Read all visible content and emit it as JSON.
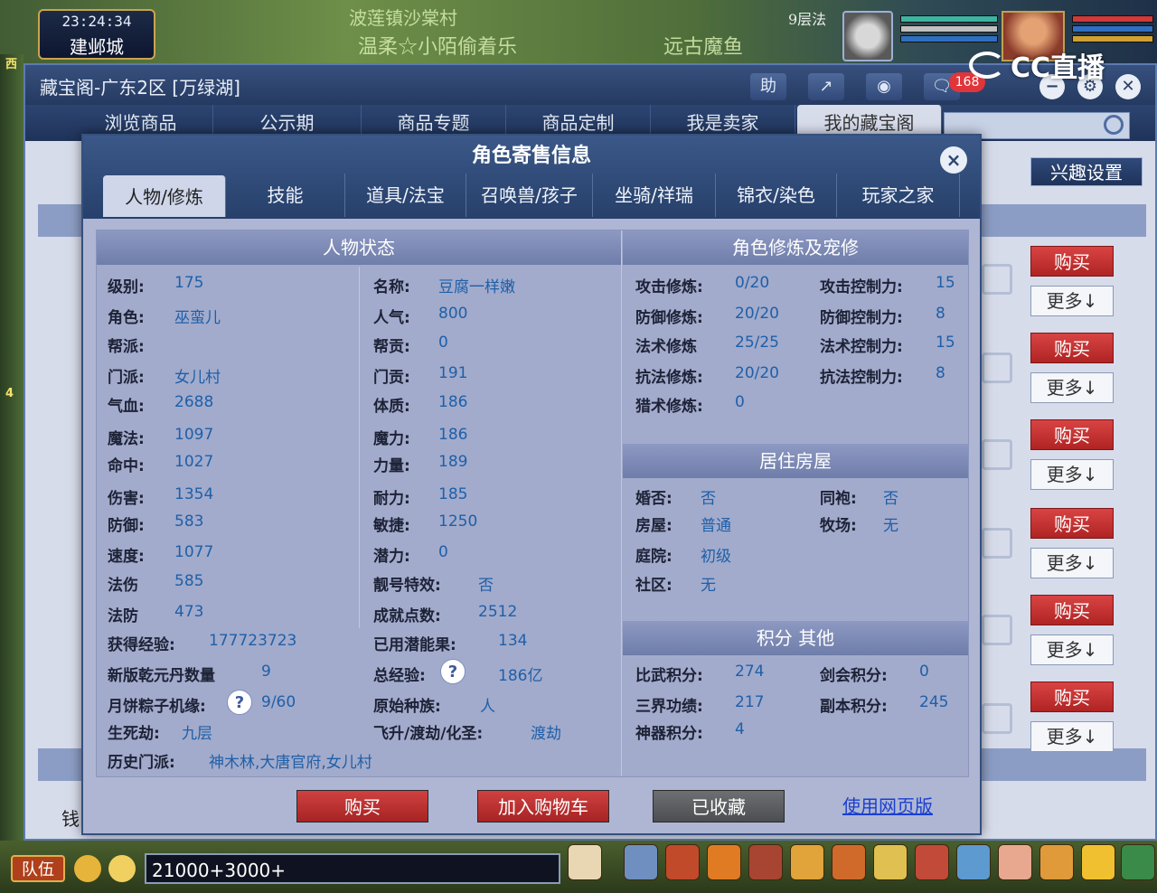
{
  "hud": {
    "time": "23:24:34",
    "city": "建邺城",
    "scroll_text_1": "波莲镇沙棠村",
    "scroll_text_2": "温柔☆小陌偷着乐",
    "scroll_text_3": "远古魔鱼",
    "scroll_text_4": "9层法",
    "left_mark_1": "西",
    "left_mark_2": "4",
    "watermark": "CC直播"
  },
  "shop": {
    "title": "藏宝阁-广东2区 [万绿湖]",
    "help_label": "助",
    "notif_count": "168",
    "nav_tabs": [
      "浏览商品",
      "公示期",
      "商品专题",
      "商品定制",
      "我是卖家",
      "我的藏宝阁"
    ],
    "interest_label": "兴趣设置",
    "money_label": "钱",
    "buy_label": "购买",
    "more_label": "更多↓"
  },
  "dialog": {
    "title": "角色寄售信息",
    "close": "×",
    "tabs": [
      "人物/修炼",
      "技能",
      "道具/法宝",
      "召唤兽/孩子",
      "坐骑/祥瑞",
      "锦衣/染色",
      "玩家之家"
    ],
    "status_header": "人物状态",
    "cultivation_header": "角色修炼及宠修",
    "house_header": "居住房屋",
    "score_header": "积分 其他",
    "left": [
      {
        "label": "级别:",
        "value": "175"
      },
      {
        "label": "角色:",
        "value": "巫蛮儿"
      },
      {
        "label": "帮派:",
        "value": ""
      },
      {
        "label": "门派:",
        "value": "女儿村"
      },
      {
        "label": "气血:",
        "value": "2688"
      },
      {
        "label": "魔法:",
        "value": "1097"
      },
      {
        "label": "命中:",
        "value": "1027"
      },
      {
        "label": "伤害:",
        "value": "1354"
      },
      {
        "label": "防御:",
        "value": "583"
      },
      {
        "label": "速度:",
        "value": "1077"
      },
      {
        "label": "法伤",
        "value": "585"
      },
      {
        "label": "法防",
        "value": "473"
      }
    ],
    "mid": [
      {
        "label": "名称:",
        "value": "豆腐一样嫩"
      },
      {
        "label": "人气:",
        "value": "800"
      },
      {
        "label": "帮贡:",
        "value": "0"
      },
      {
        "label": "门贡:",
        "value": "191"
      },
      {
        "label": "体质:",
        "value": "186"
      },
      {
        "label": "魔力:",
        "value": "186"
      },
      {
        "label": "力量:",
        "value": "189"
      },
      {
        "label": "耐力:",
        "value": "185"
      },
      {
        "label": "敏捷:",
        "value": "1250"
      },
      {
        "label": "潜力:",
        "value": "0"
      },
      {
        "label": "靓号特效:",
        "value": "否"
      },
      {
        "label": "成就点数:",
        "value": "2512"
      }
    ],
    "wide": [
      {
        "label": "获得经验:",
        "value": "177723723",
        "label2": "已用潜能果:",
        "value2": "134"
      },
      {
        "label": "新版乾元丹数量",
        "value": "9",
        "label2": "总经验:",
        "value2": "186亿"
      },
      {
        "label": "月饼粽子机缘:",
        "value": "9/60",
        "label2": "原始种族:",
        "value2": "人"
      },
      {
        "label": "生死劫:",
        "value": "九层",
        "label2": "飞升/渡劫/化圣:",
        "value2": "渡劫"
      }
    ],
    "history": {
      "label": "历史门派:",
      "value": "神木林,大唐官府,女儿村"
    },
    "cultivation": [
      {
        "label": "攻击修炼:",
        "value": "0/20",
        "label2": "攻击控制力:",
        "value2": "15"
      },
      {
        "label": "防御修炼:",
        "value": "20/20",
        "label2": "防御控制力:",
        "value2": "8"
      },
      {
        "label": "法术修炼",
        "value": "25/25",
        "label2": "法术控制力:",
        "value2": "15"
      },
      {
        "label": "抗法修炼:",
        "value": "20/20",
        "label2": "抗法控制力:",
        "value2": "8"
      },
      {
        "label": "猎术修炼:",
        "value": "0",
        "label2": "",
        "value2": ""
      }
    ],
    "house": [
      {
        "label": "婚否:",
        "value": "否",
        "label2": "同袍:",
        "value2": "否"
      },
      {
        "label": "房屋:",
        "value": "普通",
        "label2": "牧场:",
        "value2": "无"
      },
      {
        "label": "庭院:",
        "value": "初级",
        "label2": "",
        "value2": ""
      },
      {
        "label": "社区:",
        "value": "无",
        "label2": "",
        "value2": ""
      }
    ],
    "score": [
      {
        "label": "比武积分:",
        "value": "274",
        "label2": "剑会积分:",
        "value2": "0"
      },
      {
        "label": "三界功绩:",
        "value": "217",
        "label2": "副本积分:",
        "value2": "245"
      },
      {
        "label": "神器积分:",
        "value": "4",
        "label2": "",
        "value2": ""
      }
    ],
    "help_glyph": "?",
    "actions": {
      "buy": "购买",
      "cart": "加入购物车",
      "favorited": "已收藏",
      "web": "使用网页版"
    }
  },
  "bottom": {
    "team": "队伍",
    "chat_value": "21000+3000+"
  },
  "colors": {
    "accent": "#27406b",
    "buy_red": "#b02424",
    "value_blue": "#1f5fa8",
    "link_blue": "#1b3fd0"
  }
}
